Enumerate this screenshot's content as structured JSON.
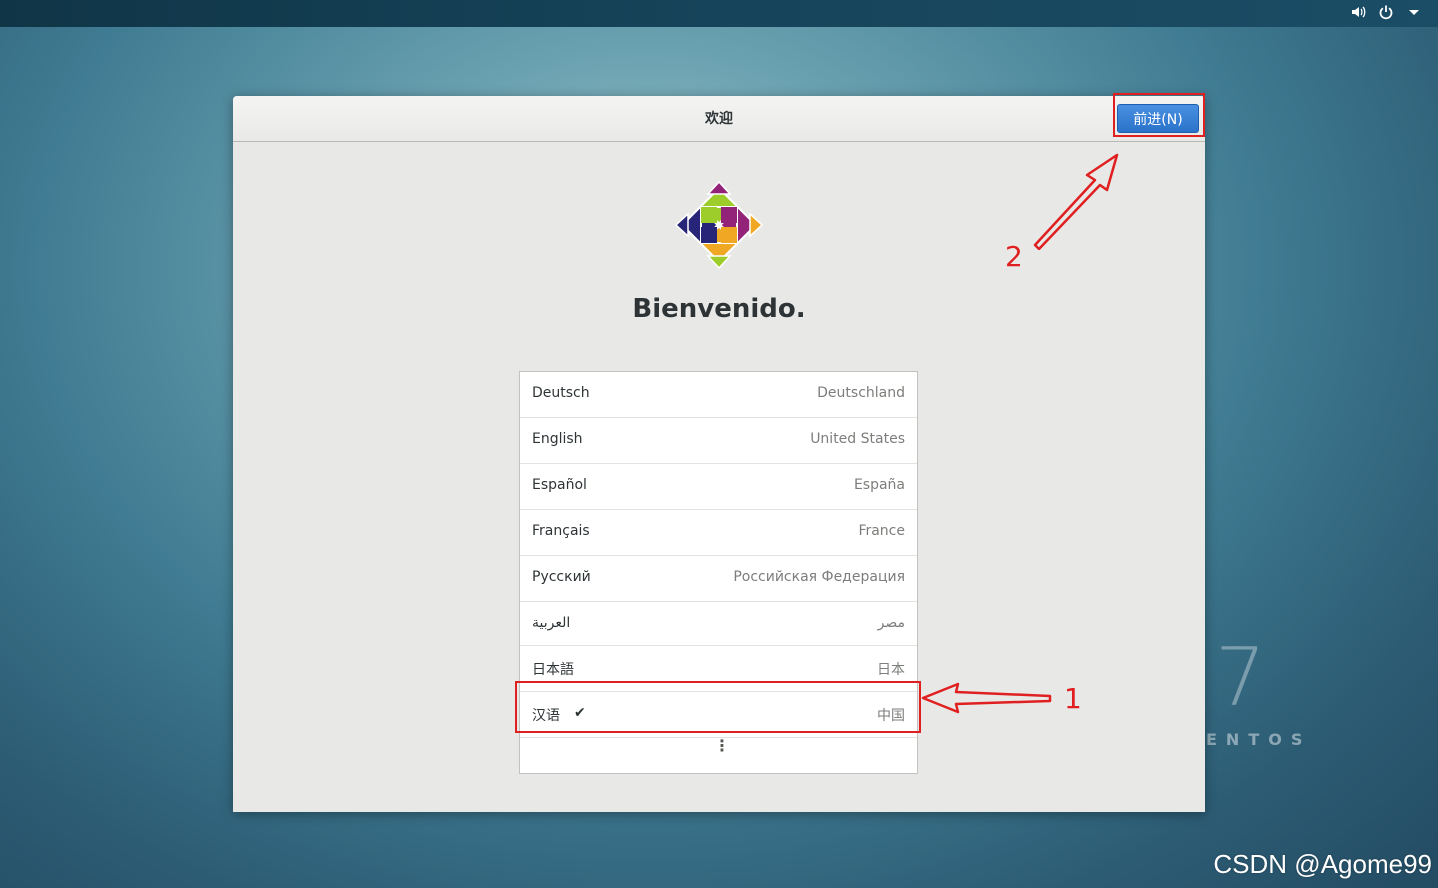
{
  "window": {
    "title": "欢迎",
    "next_label": "前进(N)",
    "welcome_text": "Bienvenido."
  },
  "languages": [
    {
      "name": "Deutsch",
      "region": "Deutschland"
    },
    {
      "name": "English",
      "region": "United States"
    },
    {
      "name": "Español",
      "region": "España"
    },
    {
      "name": "Français",
      "region": "France"
    },
    {
      "name": "Русский",
      "region": "Российская Федерация"
    },
    {
      "name": "العربية",
      "region": "مصر"
    },
    {
      "name": "日本語",
      "region": "日本"
    },
    {
      "name": "汉语",
      "region": "中国",
      "selected": true,
      "check": "✔"
    }
  ],
  "more_icon": "vertical-ellipsis-icon",
  "more_glyph": "⋮",
  "topbar": {
    "icons": [
      "volume-icon",
      "power-icon",
      "dropdown-arrow-icon"
    ]
  },
  "wallpaper": {
    "seven": "7",
    "brand": "ENTOS"
  },
  "annotations": {
    "label_1": "1",
    "label_2": "2",
    "color": "#e02020"
  },
  "watermark": "CSDN @Agome99"
}
